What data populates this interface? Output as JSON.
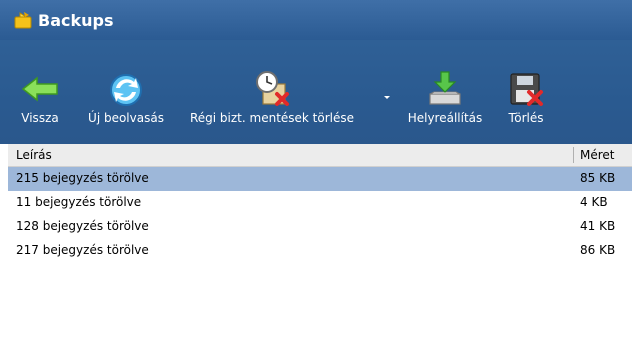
{
  "window": {
    "title": "Backups"
  },
  "toolbar": {
    "back": {
      "label": "Vissza",
      "icon": "back-arrow-icon"
    },
    "rescan": {
      "label": "Új beolvasás",
      "icon": "refresh-icon"
    },
    "delete_old": {
      "label": "Régi bizt. mentések törlése",
      "icon": "clock-delete-icon"
    },
    "restore": {
      "label": "Helyreállítás",
      "icon": "restore-icon"
    },
    "delete": {
      "label": "Törlés",
      "icon": "disk-delete-icon"
    }
  },
  "list": {
    "columns": {
      "description": "Leírás",
      "size": "Méret"
    },
    "rows": [
      {
        "description": "215 bejegyzés törölve",
        "size": "85 KB",
        "selected": true
      },
      {
        "description": "11 bejegyzés törölve",
        "size": "4 KB",
        "selected": false
      },
      {
        "description": "128 bejegyzés törölve",
        "size": "41 KB",
        "selected": false
      },
      {
        "description": "217 bejegyzés törölve",
        "size": "86 KB",
        "selected": false
      }
    ]
  },
  "colors": {
    "titlebar": "#2b5b93",
    "toolbar": "#2f6096",
    "selection": "#9db7d9",
    "header": "#ececec"
  }
}
